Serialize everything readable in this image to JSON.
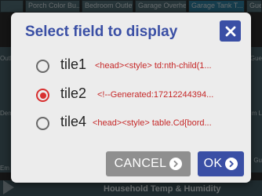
{
  "background": {
    "tiles_top": [
      "Porch Color Bu...",
      "Bedroom Outlet",
      "Garage Overhe...",
      "Garage Tank T...",
      "Gue"
    ],
    "side_labels": [
      "Outle",
      "Gue",
      "Dem",
      "m L",
      "Gu",
      "Em"
    ],
    "bottom_bar": "Household Temp & Humidity"
  },
  "dialog": {
    "title": "Select field to display",
    "options": [
      {
        "name": "tile1",
        "preview": "<head><style> td:nth-child(1...",
        "selected": false
      },
      {
        "name": "tile2",
        "preview": "<!--Generated:17212244394...",
        "selected": true
      },
      {
        "name": "tile4",
        "preview": "<head><style> table.Cd{bord...",
        "selected": false
      }
    ],
    "cancel_label": "CANCEL",
    "ok_label": "OK"
  },
  "colors": {
    "accent": "#3a4fa5",
    "radio_selected": "#d83030",
    "preview_text": "#c62828",
    "cancel_button": "#8f8f8f"
  },
  "icons": {
    "close": "close-icon",
    "button_chevron": "chevron-right-circle-icon"
  }
}
